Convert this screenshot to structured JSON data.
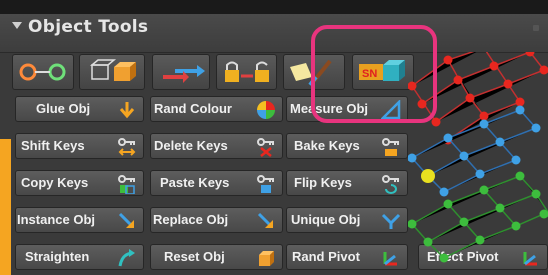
{
  "panel": {
    "title": "Object Tools"
  },
  "icon_row": [
    {
      "name": "circles-link-icon"
    },
    {
      "name": "cubes-icon"
    },
    {
      "name": "arrows-swap-icon"
    },
    {
      "name": "padlocks-icon"
    },
    {
      "name": "brush-icon"
    },
    {
      "name": "sn-cube-icon"
    }
  ],
  "buttons": {
    "row1": [
      "Glue Obj",
      "Rand Colour",
      "Measure Obj"
    ],
    "row2": [
      "Shift Keys",
      "Delete Keys",
      "Bake Keys"
    ],
    "row3": [
      "Copy Keys",
      "Paste Keys",
      "Flip Keys"
    ],
    "row4": [
      "Instance Obj",
      "Replace Obj",
      "Unique Obj"
    ],
    "row5": [
      "Straighten",
      "Reset Obj",
      "Rand Pivot",
      "Effect Pivot"
    ]
  },
  "colors": {
    "highlight": "#e8347e",
    "accent_orange": "#f5a521",
    "node_red": "#e8271f",
    "node_blue": "#3fa1e6",
    "node_green": "#3dbd3d",
    "node_yellow": "#e8e020"
  }
}
